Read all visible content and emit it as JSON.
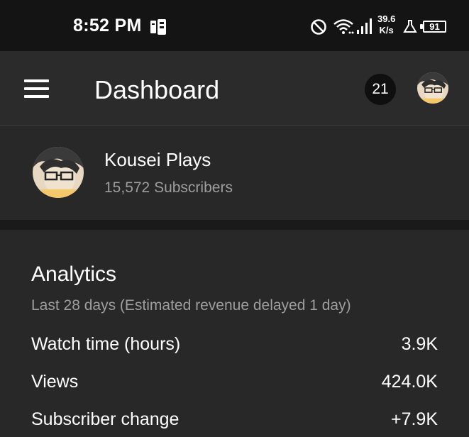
{
  "status_bar": {
    "time": "8:52 PM",
    "net_speed_value": "39.6",
    "net_speed_unit": "K/s",
    "battery": "91",
    "icons": [
      "notes-app-icon",
      "do-not-disturb-icon",
      "wifi-icon",
      "signal-icon",
      "flask-icon",
      "battery-icon"
    ]
  },
  "header": {
    "title": "Dashboard",
    "notification_count": "21",
    "menu_icon": "hamburger-menu-icon",
    "avatar": "channel-avatar"
  },
  "channel": {
    "name": "Kousei Plays",
    "subscribers": "15,572 Subscribers"
  },
  "analytics": {
    "title": "Analytics",
    "subtitle": "Last 28 days (Estimated revenue delayed 1 day)",
    "metrics": [
      {
        "label": "Watch time (hours)",
        "value": "3.9K"
      },
      {
        "label": "Views",
        "value": "424.0K"
      },
      {
        "label": "Subscriber change",
        "value": "+7.9K"
      }
    ]
  },
  "colors": {
    "status_bar_bg": "#141414",
    "app_bar_bg": "#2b2b2b",
    "card_bg": "#282828",
    "secondary_text": "#9e9e9e"
  }
}
